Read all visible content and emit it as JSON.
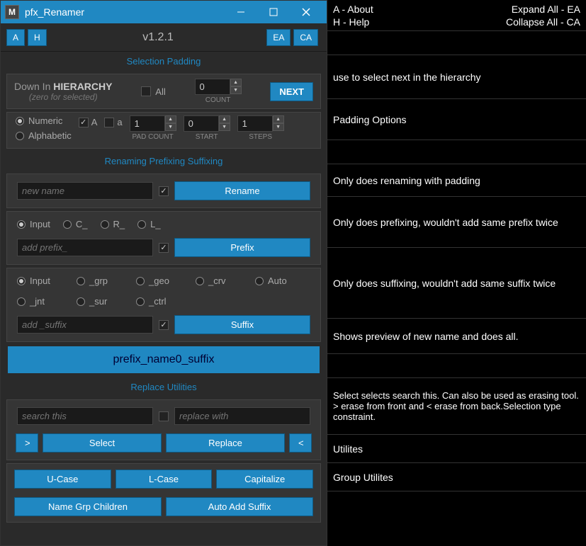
{
  "window": {
    "title": "pfx_Renamer"
  },
  "header": {
    "a": "A",
    "h": "H",
    "version": "v1.2.1",
    "ea": "EA",
    "ca": "CA"
  },
  "sections": {
    "selection_padding": "Selection Padding",
    "renaming": "Renaming Prefixing Suffixing",
    "replace": "Replace Utilities"
  },
  "hierarchy": {
    "down": "Down In ",
    "hierarchy": "HIERARCHY",
    "zero": "(zero for selected)",
    "all": "All",
    "count_value": "0",
    "count_label": "COUNT",
    "next": "NEXT"
  },
  "padding": {
    "numeric": "Numeric",
    "alphabetic": "Alphabetic",
    "A": "A",
    "a": "a",
    "pad_count": "1",
    "pad_count_label": "PAD COUNT",
    "start": "0",
    "start_label": "START",
    "steps": "1",
    "steps_label": "STEPS"
  },
  "rename": {
    "placeholder": "new name",
    "button": "Rename"
  },
  "prefix": {
    "input": "Input",
    "c": "C_",
    "r": "R_",
    "l": "L_",
    "placeholder": "add prefix_",
    "button": "Prefix"
  },
  "suffix": {
    "input": "Input",
    "auto": "Auto",
    "grp": "_grp",
    "jnt": "_jnt",
    "geo": "_geo",
    "sur": "_sur",
    "crv": "_crv",
    "ctrl": "_ctrl",
    "placeholder": "add _suffix",
    "button": "Suffix"
  },
  "preview": "prefix_name0_suffix",
  "replace": {
    "search_placeholder": "search this",
    "replace_placeholder": "replace with",
    "lt": ">",
    "select": "Select",
    "replace_btn": "Replace",
    "gt": "<"
  },
  "util": {
    "ucase": "U-Case",
    "lcase": "L-Case",
    "cap": "Capitalize",
    "grpchildren": "Name Grp Children",
    "autosuffix": "Auto Add Suffix"
  },
  "annotations": {
    "legend_a": "A - About",
    "legend_h": "H - Help",
    "legend_ea": "Expand All - EA",
    "legend_ca": "Collapse All - CA",
    "hierarchy": "use to select next in the hierarchy",
    "padding": "Padding Options",
    "rename": "Only does renaming with padding",
    "prefix": "Only does prefixing, wouldn't add same prefix twice",
    "suffix": "Only does suffixing, wouldn't add same suffix twice",
    "preview": "Shows preview of new name and does all.",
    "replace": "Select selects search this. Can also be used as erasing tool. > erase from front and < erase from back.Selection type constraint.",
    "util": "Utilites",
    "grputil": "Group Utilites"
  }
}
